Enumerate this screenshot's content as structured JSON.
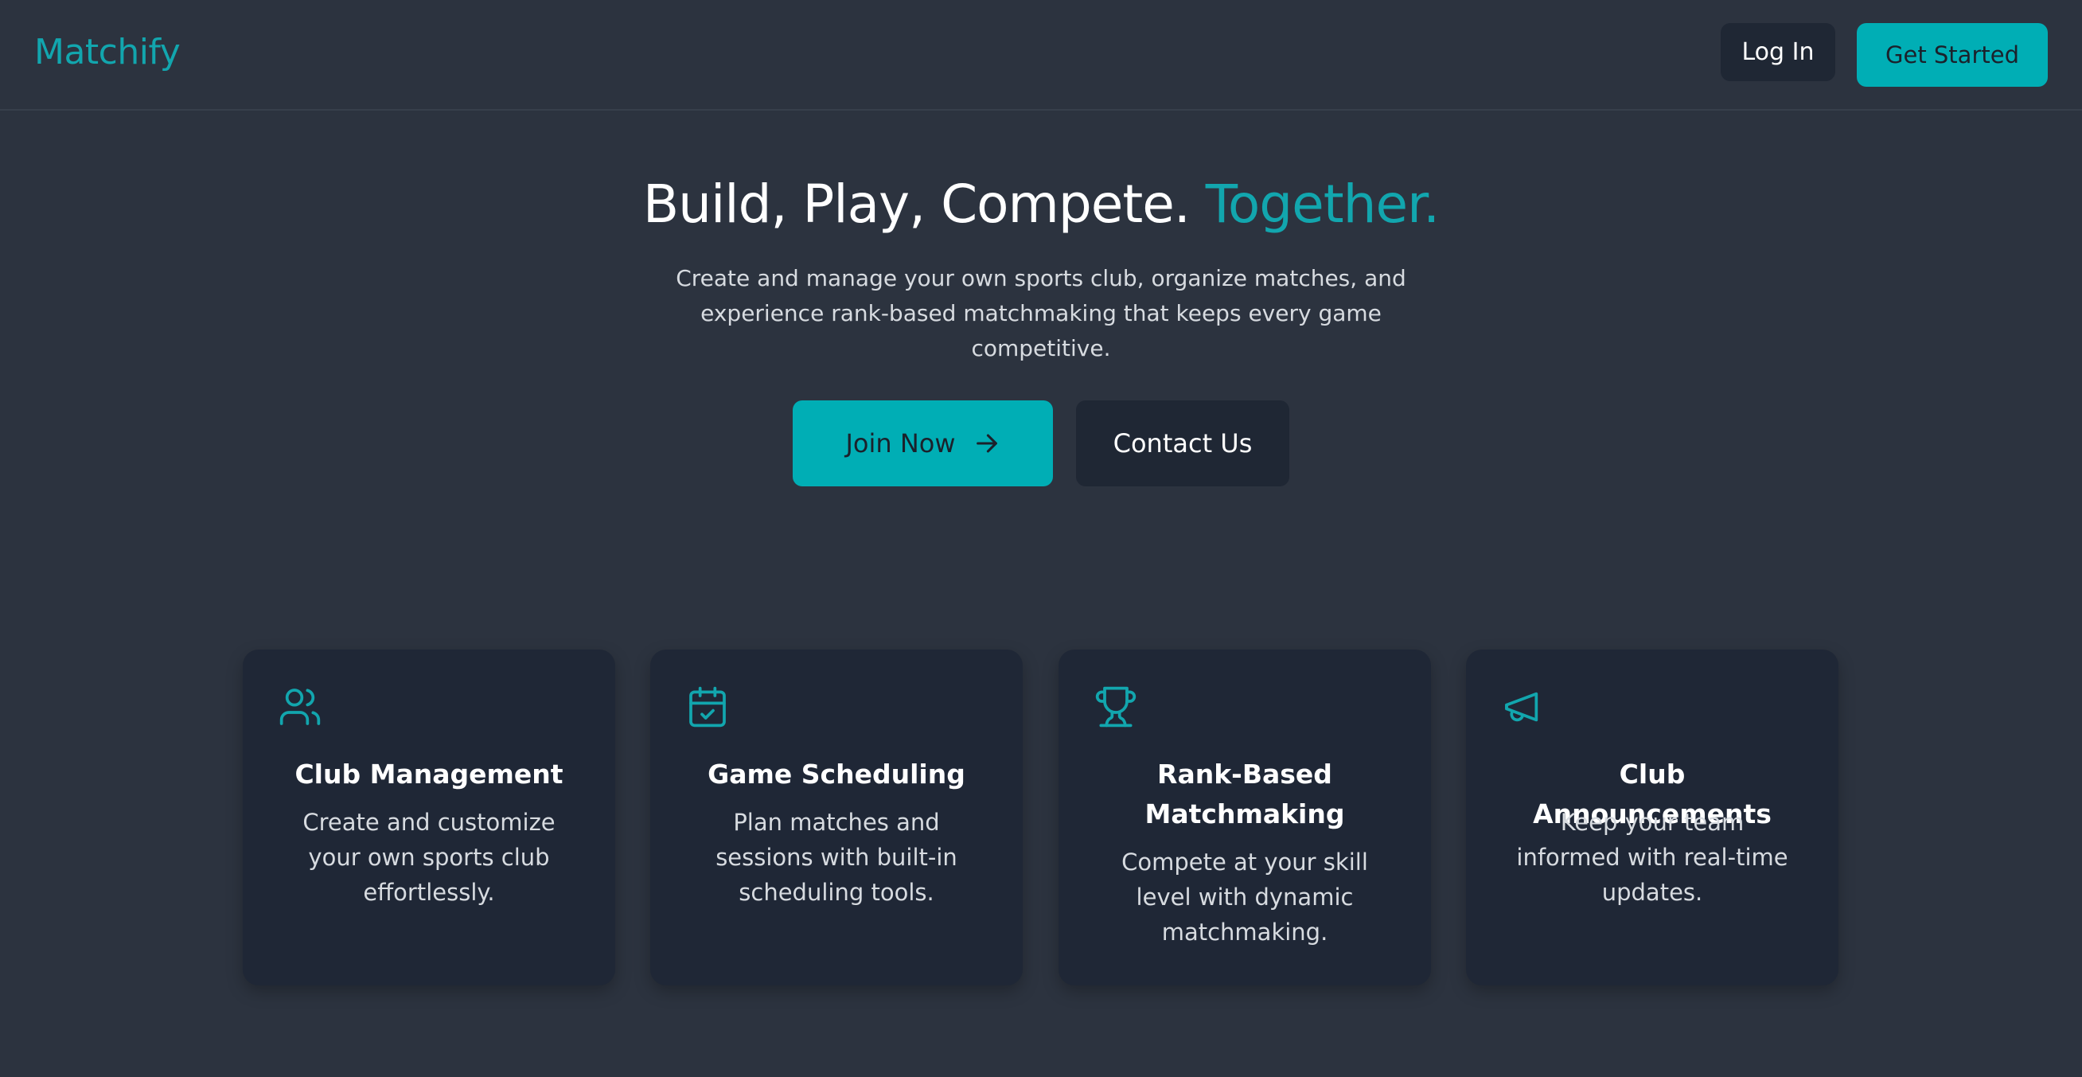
{
  "header": {
    "logo": "Matchify",
    "login_label": "Log In",
    "get_started_label": "Get Started"
  },
  "hero": {
    "title_main": "Build, Play, Compete.",
    "title_accent": "Together.",
    "subtitle": "Create and manage your own sports club, organize matches, and experience rank-based matchmaking that keeps every game competitive.",
    "join_label": "Join Now",
    "contact_label": "Contact Us"
  },
  "features": [
    {
      "icon": "users-icon",
      "title": "Club Management",
      "description": "Create and customize your own sports club effortlessly."
    },
    {
      "icon": "calendar-check-icon",
      "title": "Game Scheduling",
      "description": "Plan matches and sessions with built-in scheduling tools."
    },
    {
      "icon": "trophy-icon",
      "title": "Rank-Based Matchmaking",
      "description": "Compete at your skill level with dynamic matchmaking."
    },
    {
      "icon": "megaphone-icon",
      "title": "Club Announcements",
      "description": "Keep your team informed with real-time updates."
    }
  ],
  "colors": {
    "background": "#2c333f",
    "card": "#1f2736",
    "accent": "#00aeb5",
    "accent_text": "#12a6ae"
  }
}
